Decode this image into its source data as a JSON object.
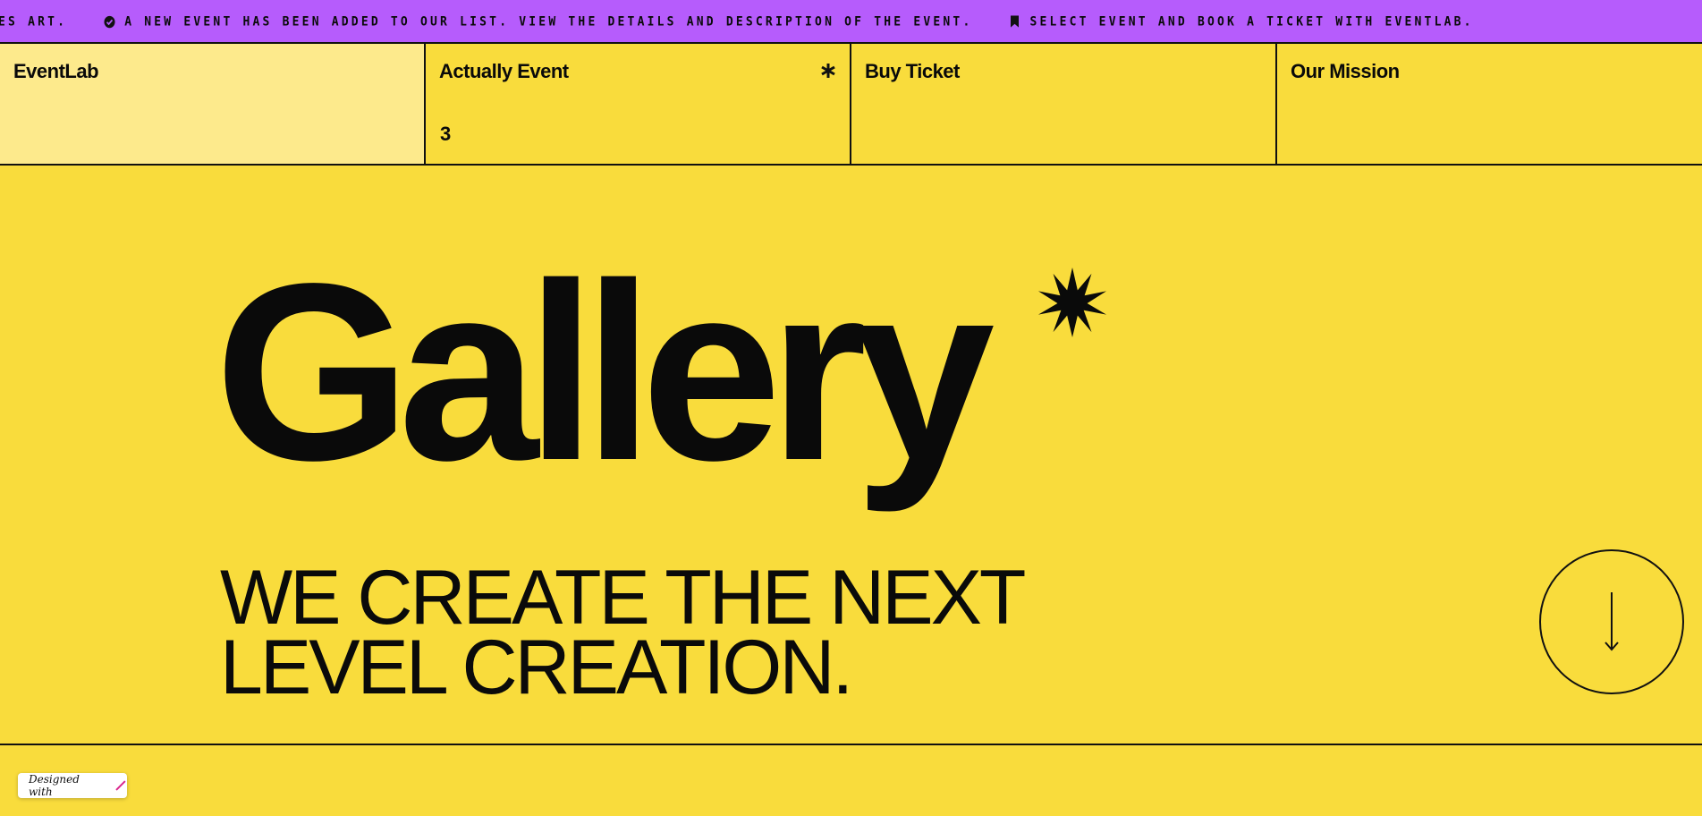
{
  "ticker": {
    "items": [
      {
        "text": "ES ART.",
        "icon": ""
      },
      {
        "text": "A NEW EVENT HAS BEEN ADDED TO OUR LIST. VIEW THE DETAILS AND DESCRIPTION OF THE EVENT.",
        "icon": "check-circle-icon"
      },
      {
        "text": "SELECT EVENT AND BOOK A TICKET WITH EVENTLAB.",
        "icon": "bookmark-icon"
      }
    ]
  },
  "nav": {
    "brand": "EventLab",
    "actually_event": "Actually Event",
    "actually_event_count": "3",
    "buy_ticket": "Buy Ticket",
    "our_mission": "Our Mission"
  },
  "hero": {
    "title": "Gallery",
    "tagline_line1": "WE CREATE THE NEXT",
    "tagline_line2": "LEVEL CREATION."
  },
  "badge": {
    "label": "Designed with"
  },
  "colors": {
    "background": "#f9dc3c",
    "ticker": "#b65cfc",
    "brand_cell": "#fdea8c",
    "ink": "#0a0a0a",
    "badge_accent": "#d9258c"
  }
}
